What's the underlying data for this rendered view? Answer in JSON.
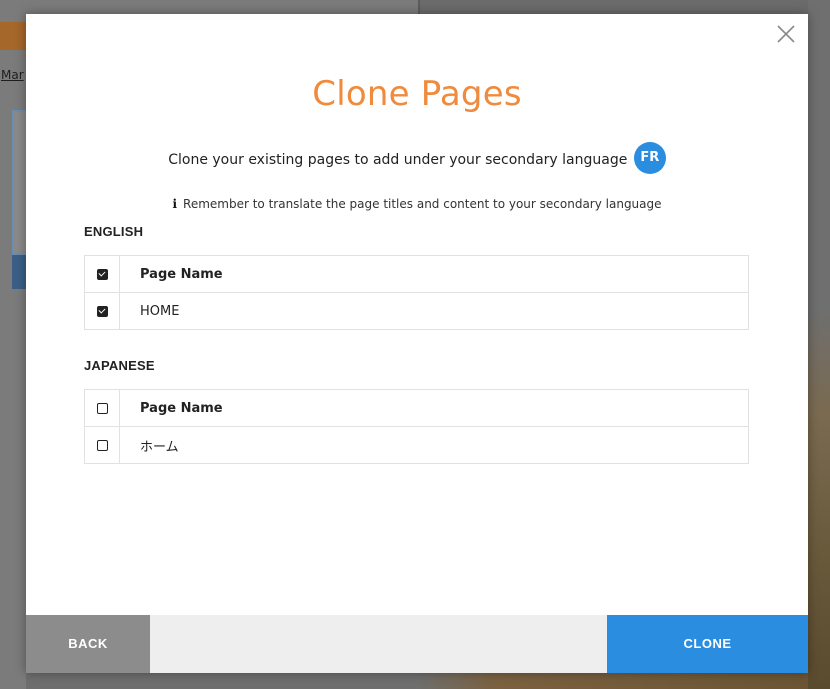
{
  "background": {
    "link_text": "Mar"
  },
  "modal": {
    "title": "Clone Pages",
    "subtitle": "Clone your existing pages to add under your secondary language",
    "language_badge": "FR",
    "note_icon": "info-icon",
    "note": "Remember to translate the page titles and content to your secondary language",
    "close_icon": "close-icon"
  },
  "sections": [
    {
      "heading": "ENGLISH",
      "column_header": "Page Name",
      "header_checked": true,
      "rows": [
        {
          "name": "HOME",
          "checked": true
        }
      ]
    },
    {
      "heading": "JAPANESE",
      "column_header": "Page Name",
      "header_checked": false,
      "rows": [
        {
          "name": "ホーム",
          "checked": false
        }
      ]
    }
  ],
  "footer": {
    "back_label": "BACK",
    "clone_label": "CLONE"
  },
  "colors": {
    "title": "#f08a3c",
    "accent": "#2b8de0",
    "back_button": "#8c8c8c"
  }
}
